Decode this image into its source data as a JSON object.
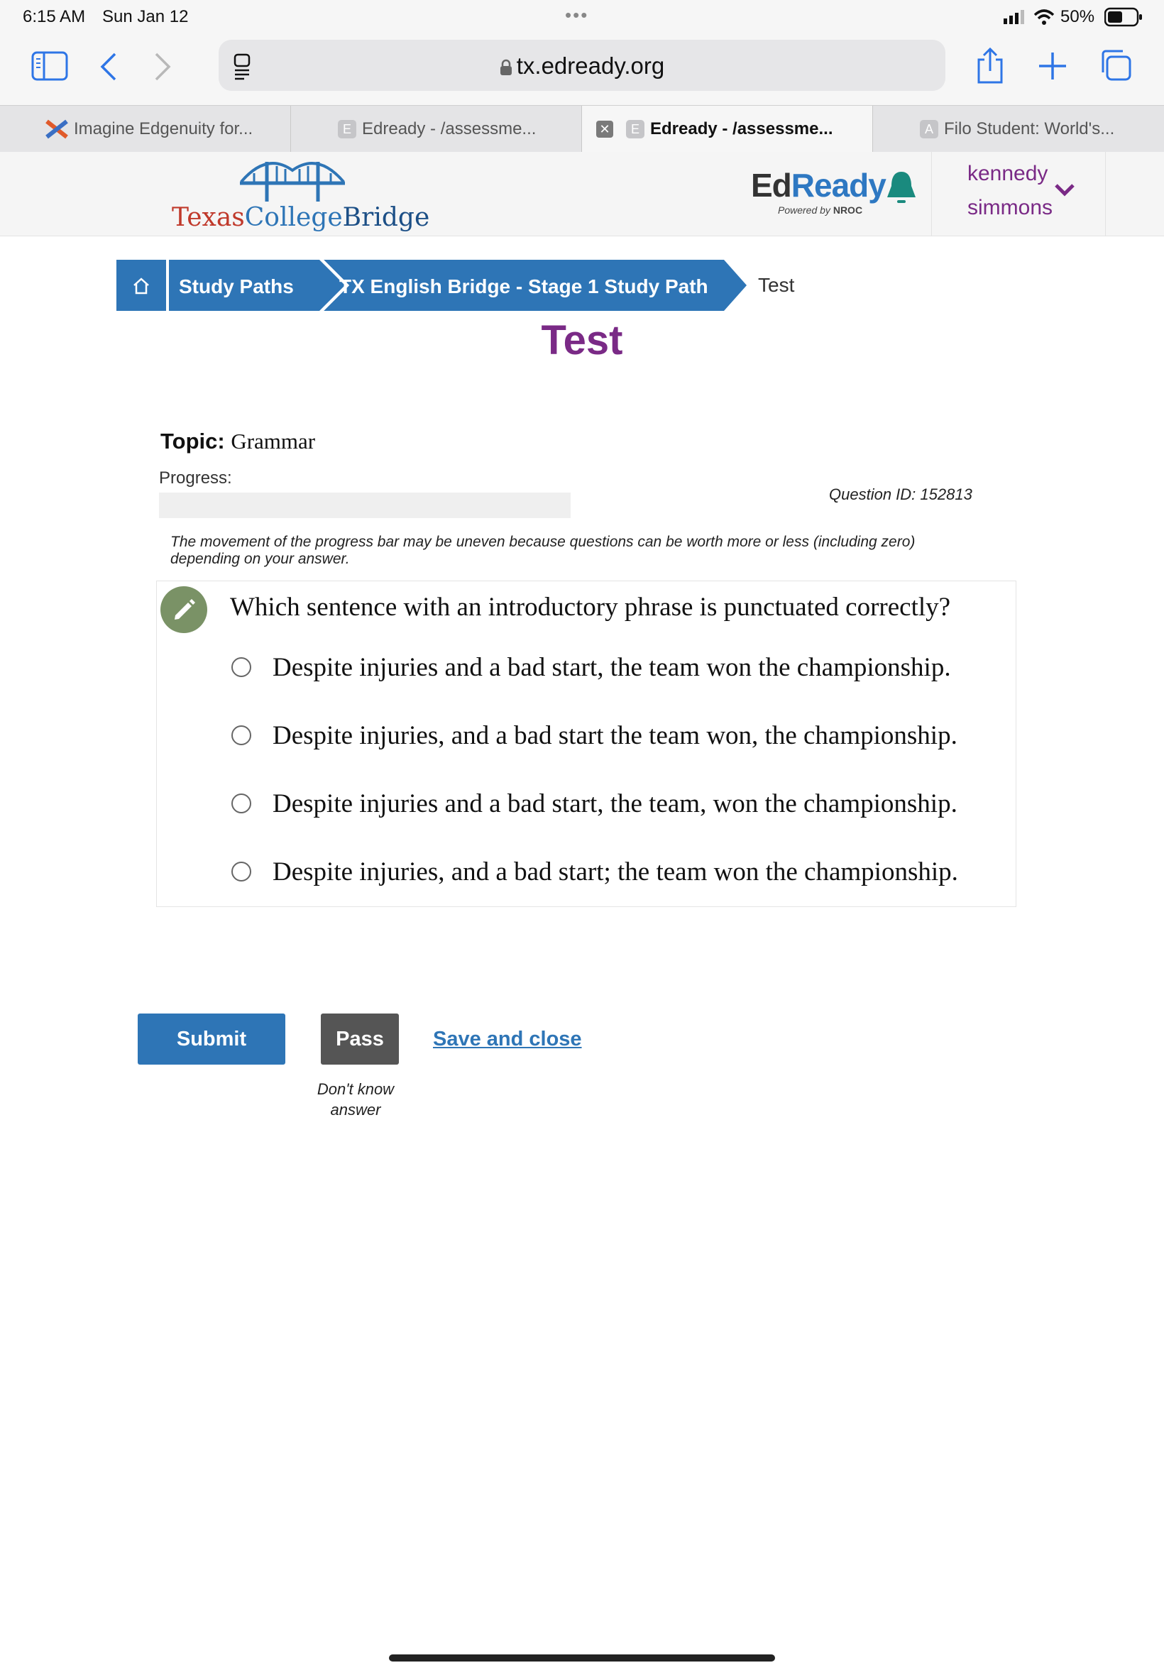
{
  "status_bar": {
    "time": "6:15 AM",
    "date": "Sun Jan 12",
    "battery": "50%"
  },
  "browser": {
    "url": "tx.edready.org",
    "tabs": [
      {
        "favicon": "x-logo",
        "title": "Imagine Edgenuity for...",
        "active": false
      },
      {
        "favicon": "E",
        "title": "Edready - /assessme...",
        "active": false
      },
      {
        "favicon": "E",
        "title": "Edready - /assessme...",
        "active": true
      },
      {
        "favicon": "A",
        "title": "Filo Student: World's...",
        "active": false
      }
    ]
  },
  "header": {
    "brand_left": {
      "part1": "Texas",
      "part2": "College",
      "part3": "Bridge"
    },
    "brand_right": {
      "ed": "Ed",
      "ready": "Ready",
      "powered_prefix": "Powered by",
      "powered_name": "NROC"
    },
    "user": {
      "first": "kennedy",
      "last": "simmons"
    }
  },
  "breadcrumb": {
    "items": [
      "Study Paths",
      "TX English Bridge - Stage 1 Study Path"
    ],
    "current": "Test"
  },
  "page": {
    "title": "Test",
    "topic_label": "Topic:",
    "topic_value": "Grammar",
    "progress_label": "Progress:",
    "progress_fraction": 0,
    "question_id": "Question ID: 152813",
    "note": "The movement of the progress bar may be uneven because questions can be worth more or less (including zero) depending on your answer."
  },
  "question": {
    "prompt": "Which sentence with an introductory phrase is punctuated correctly?",
    "options": [
      "Despite injuries and a bad start, the team won the championship.",
      "Despite injuries, and a bad start the team won, the championship.",
      "Despite injuries and a bad start, the team, won the championship.",
      "Despite injuries, and a bad start; the team won the championship."
    ]
  },
  "actions": {
    "submit": "Submit",
    "pass": "Pass",
    "save_close": "Save and close",
    "pass_hint_line1": "Don't know",
    "pass_hint_line2": "answer"
  },
  "colors": {
    "brand_blue": "#2e75b6",
    "brand_purple": "#7a2a86",
    "bell_teal": "#1a8a7e",
    "pencil_green": "#7a9266"
  }
}
